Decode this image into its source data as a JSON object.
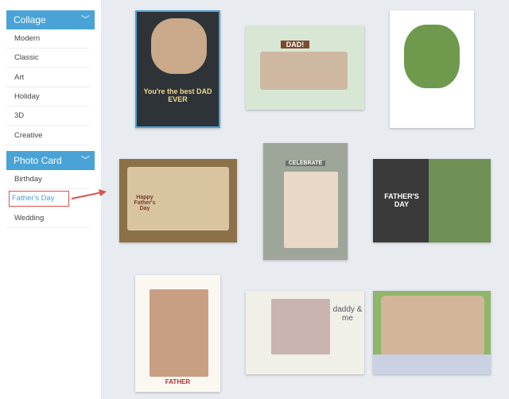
{
  "sidebar": {
    "sections": [
      {
        "label": "Collage",
        "items": [
          "Modern",
          "Classic",
          "Art",
          "Holiday",
          "3D",
          "Creative"
        ]
      },
      {
        "label": "Photo Card",
        "items": [
          "Birthday",
          "Father's Day",
          "Wedding"
        ],
        "active": "Father's Day"
      }
    ]
  },
  "colors": {
    "accent": "#4aa3d6",
    "highlight": "#d9534f"
  },
  "templates": [
    {
      "text": "You're the best DAD EVER",
      "selected": true
    },
    {
      "text": "DAD!"
    },
    {
      "text": ""
    },
    {
      "text": "Happy Father's Day"
    },
    {
      "text": "CELEBRATE"
    },
    {
      "text": "FATHER'S DAY"
    },
    {
      "text": "FATHER"
    },
    {
      "text": "daddy & me"
    },
    {
      "text": ""
    }
  ]
}
